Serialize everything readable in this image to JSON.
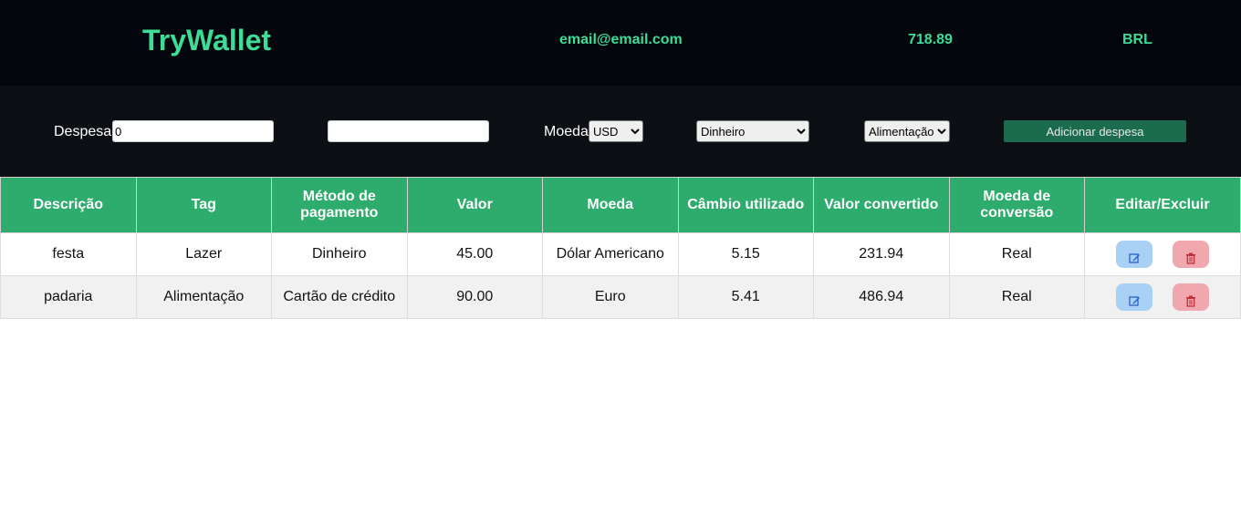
{
  "header": {
    "logo": "TryWallet",
    "email": "email@email.com",
    "total": "718.89",
    "currency": "BRL"
  },
  "form": {
    "expense_label": "Despesa",
    "value_input": "0",
    "description_input": "",
    "currency_label": "Moeda",
    "currency_selected": "USD",
    "method_selected": "Dinheiro",
    "tag_selected": "Alimentação",
    "add_button": "Adicionar despesa"
  },
  "table": {
    "headers": [
      "Descrição",
      "Tag",
      "Método de pagamento",
      "Valor",
      "Moeda",
      "Câmbio utilizado",
      "Valor convertido",
      "Moeda de conversão",
      "Editar/Excluir"
    ],
    "rows": [
      {
        "description": "festa",
        "tag": "Lazer",
        "method": "Dinheiro",
        "value": "45.00",
        "currency": "Dólar Americano",
        "rate": "5.15",
        "converted": "231.94",
        "conversion_currency": "Real"
      },
      {
        "description": "padaria",
        "tag": "Alimentação",
        "method": "Cartão de crédito",
        "value": "90.00",
        "currency": "Euro",
        "rate": "5.41",
        "converted": "486.94",
        "conversion_currency": "Real"
      }
    ]
  },
  "colors": {
    "accent": "#3ddc97",
    "table_header": "#2eac6d",
    "edit_button": "#a8d1f5",
    "delete_button": "#f0a7ad"
  },
  "icons": {
    "edit": "edit-icon",
    "delete": "trash-icon"
  }
}
